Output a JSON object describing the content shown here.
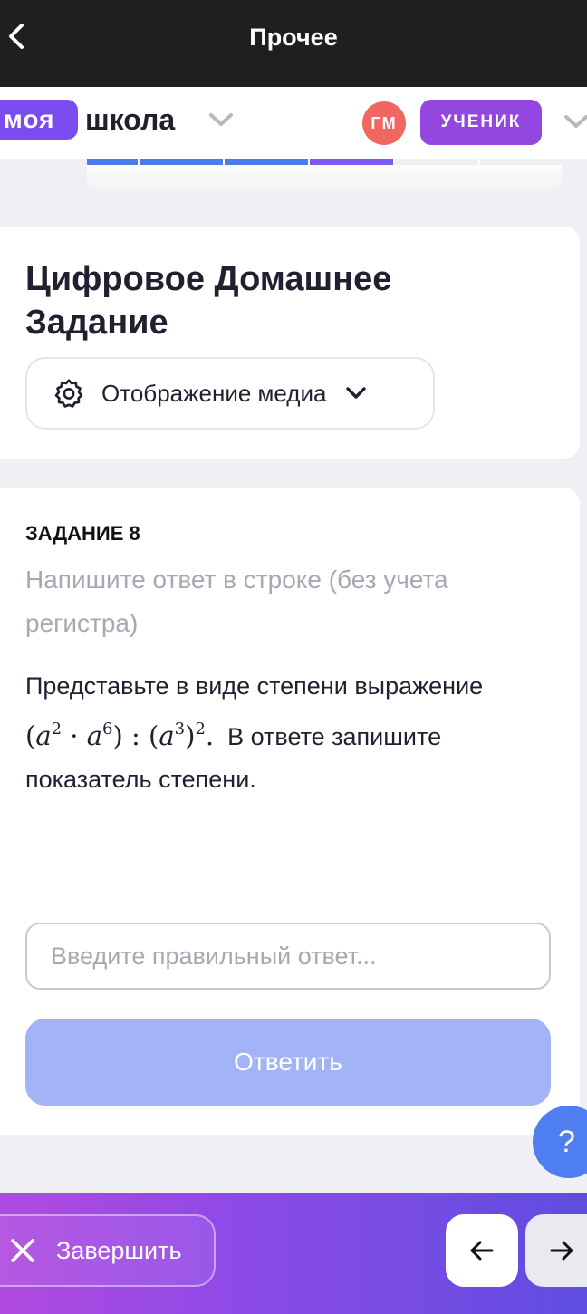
{
  "topbar": {
    "title": "Прочее"
  },
  "header": {
    "logo_highlight": "моя",
    "logo_rest": "школа",
    "avatar_initials": "ГМ",
    "role_label": "УЧЕНИК"
  },
  "progress": {
    "colors": [
      "#4a7cf0",
      "#4a7cf0",
      "#4a7cf0",
      "#7b5bf0"
    ]
  },
  "card": {
    "title": "Цифровое Домашнее Задание",
    "media_dropdown_label": "Отображение медиа"
  },
  "task": {
    "title": "ЗАДАНИЕ 8",
    "hint": "Напишите ответ в строке (без учета регистра)",
    "text_before": "Представьте в виде степени выражение",
    "text_after": "В ответе запишите показатель степени.",
    "answer_placeholder": "Введите правильный ответ...",
    "submit_label": "Ответить"
  },
  "help": {
    "label": "?"
  },
  "bottombar": {
    "finish_label": "Завершить"
  },
  "colors": {
    "accent_purple": "#7a4cf0",
    "role_purple": "#9447e0",
    "avatar_red": "#f06762",
    "submit_disabled": "#a2b4f6",
    "help_blue": "#4e7ef0"
  }
}
